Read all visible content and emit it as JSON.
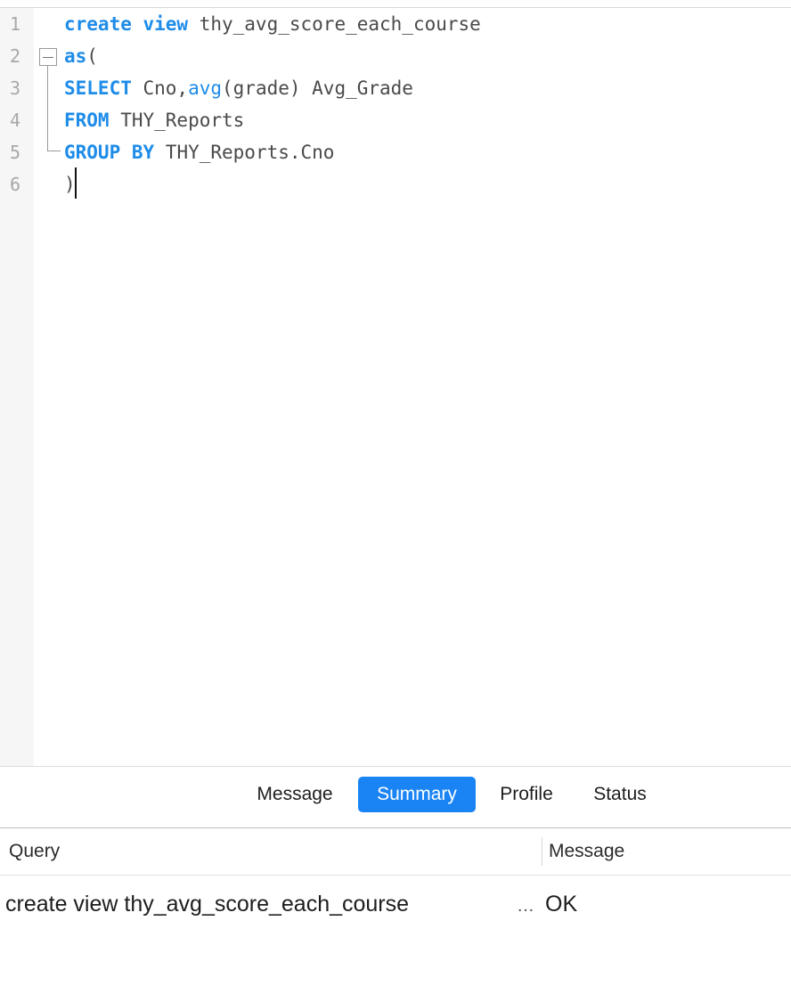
{
  "editor": {
    "line_numbers": [
      "1",
      "2",
      "3",
      "4",
      "5",
      "6"
    ],
    "lines": [
      [
        {
          "t": "create view",
          "c": "kw"
        },
        {
          "t": " thy_avg_score_each_course",
          "c": ""
        }
      ],
      [
        {
          "t": "as",
          "c": "kw"
        },
        {
          "t": "(",
          "c": ""
        }
      ],
      [
        {
          "t": "SELECT",
          "c": "kw"
        },
        {
          "t": " Cno,",
          "c": ""
        },
        {
          "t": "avg",
          "c": "fn"
        },
        {
          "t": "(grade) Avg_Grade",
          "c": ""
        }
      ],
      [
        {
          "t": "FROM",
          "c": "kw"
        },
        {
          "t": " THY_Reports",
          "c": ""
        }
      ],
      [
        {
          "t": "GROUP BY",
          "c": "kw"
        },
        {
          "t": " THY_Reports.Cno",
          "c": ""
        }
      ],
      [
        {
          "t": ")",
          "c": ""
        }
      ]
    ]
  },
  "tabs": {
    "message": "Message",
    "summary": "Summary",
    "profile": "Profile",
    "status": "Status",
    "active": "Summary"
  },
  "results": {
    "columns": {
      "query": "Query",
      "message": "Message"
    },
    "rows": [
      {
        "query": "create view thy_avg_score_each_course",
        "ellipsis": "…",
        "message": "OK"
      }
    ]
  },
  "colors": {
    "keyword": "#1e8ce8",
    "active_tab": "#1a84f4"
  }
}
